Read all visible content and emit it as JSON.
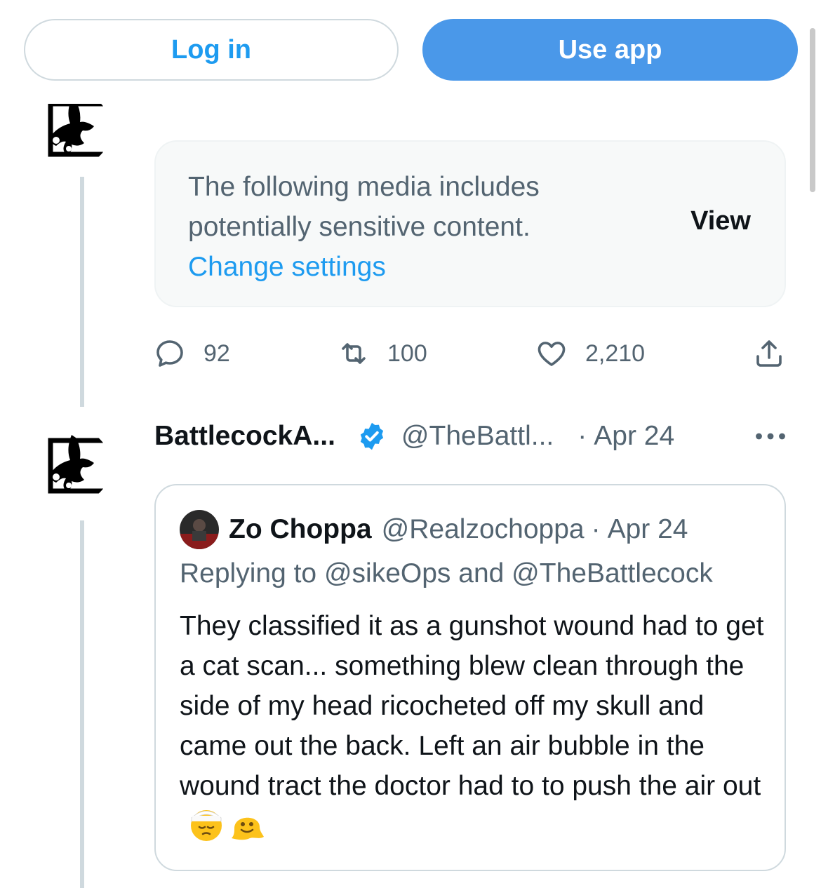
{
  "topbar": {
    "login_label": "Log in",
    "use_app_label": "Use app"
  },
  "sensitive_media": {
    "message": "The following media includes potentially sensitive content.",
    "change_settings_label": "Change settings",
    "view_label": "View"
  },
  "actions": {
    "replies": "92",
    "reposts": "100",
    "likes": "2,210"
  },
  "tweet": {
    "author_name": "BattlecockA...",
    "handle": "@TheBattl...",
    "separator": "·",
    "date": "Apr 24",
    "verified_icon": "verified-badge-icon"
  },
  "quote": {
    "author_name": "Zo Choppa",
    "handle": "@Realzochoppa",
    "separator": "·",
    "date": "Apr 24",
    "replying_to": "Replying to @sikeOps and @TheBattlecock",
    "body": "They classified it as a gunshot wound had to get a cat scan... something blew clean through the side of my head ricocheted off my skull and came out the back. Left an air bubble in the wound tract the doctor had to to push the air out",
    "emojis": [
      "face-with-head-bandage",
      "melting-face"
    ]
  },
  "colors": {
    "accent": "#1d9bf0",
    "use_app_bg": "#4a98e9",
    "muted_text": "#536471",
    "border": "#cfd9de"
  }
}
